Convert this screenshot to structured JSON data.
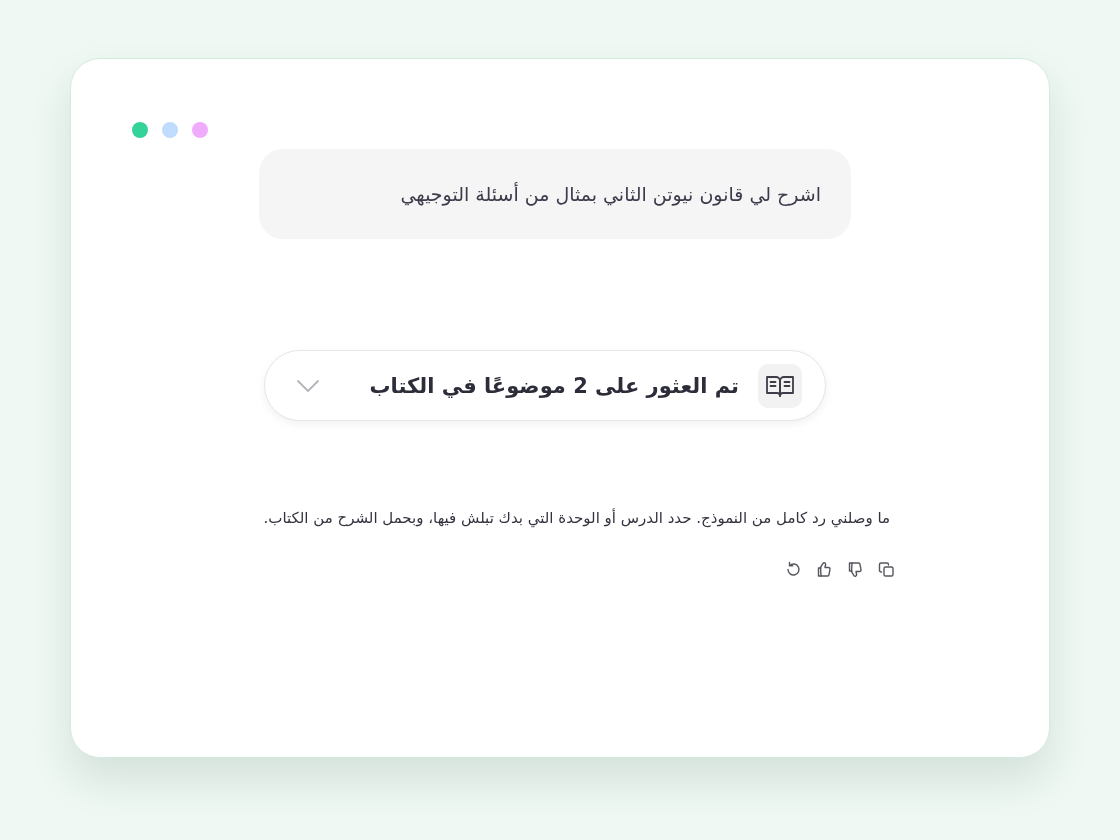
{
  "window": {
    "dots": [
      {
        "color": "#34d399"
      },
      {
        "color": "#bfdbfe"
      },
      {
        "color": "#f0abfc"
      }
    ]
  },
  "user_message": {
    "text": "اشرح لي قانون نيوتن الثاني بمثال من أسئلة التوجيهي"
  },
  "sources": {
    "label": "تم العثور على 2 موضوعًا في الكتاب",
    "expanded": false
  },
  "reply": {
    "text": "ما وصلني رد كامل من النموذج. حدد الدرس أو الوحدة التي بدك تبلش فيها، وبحمل الشرح من الكتاب."
  }
}
